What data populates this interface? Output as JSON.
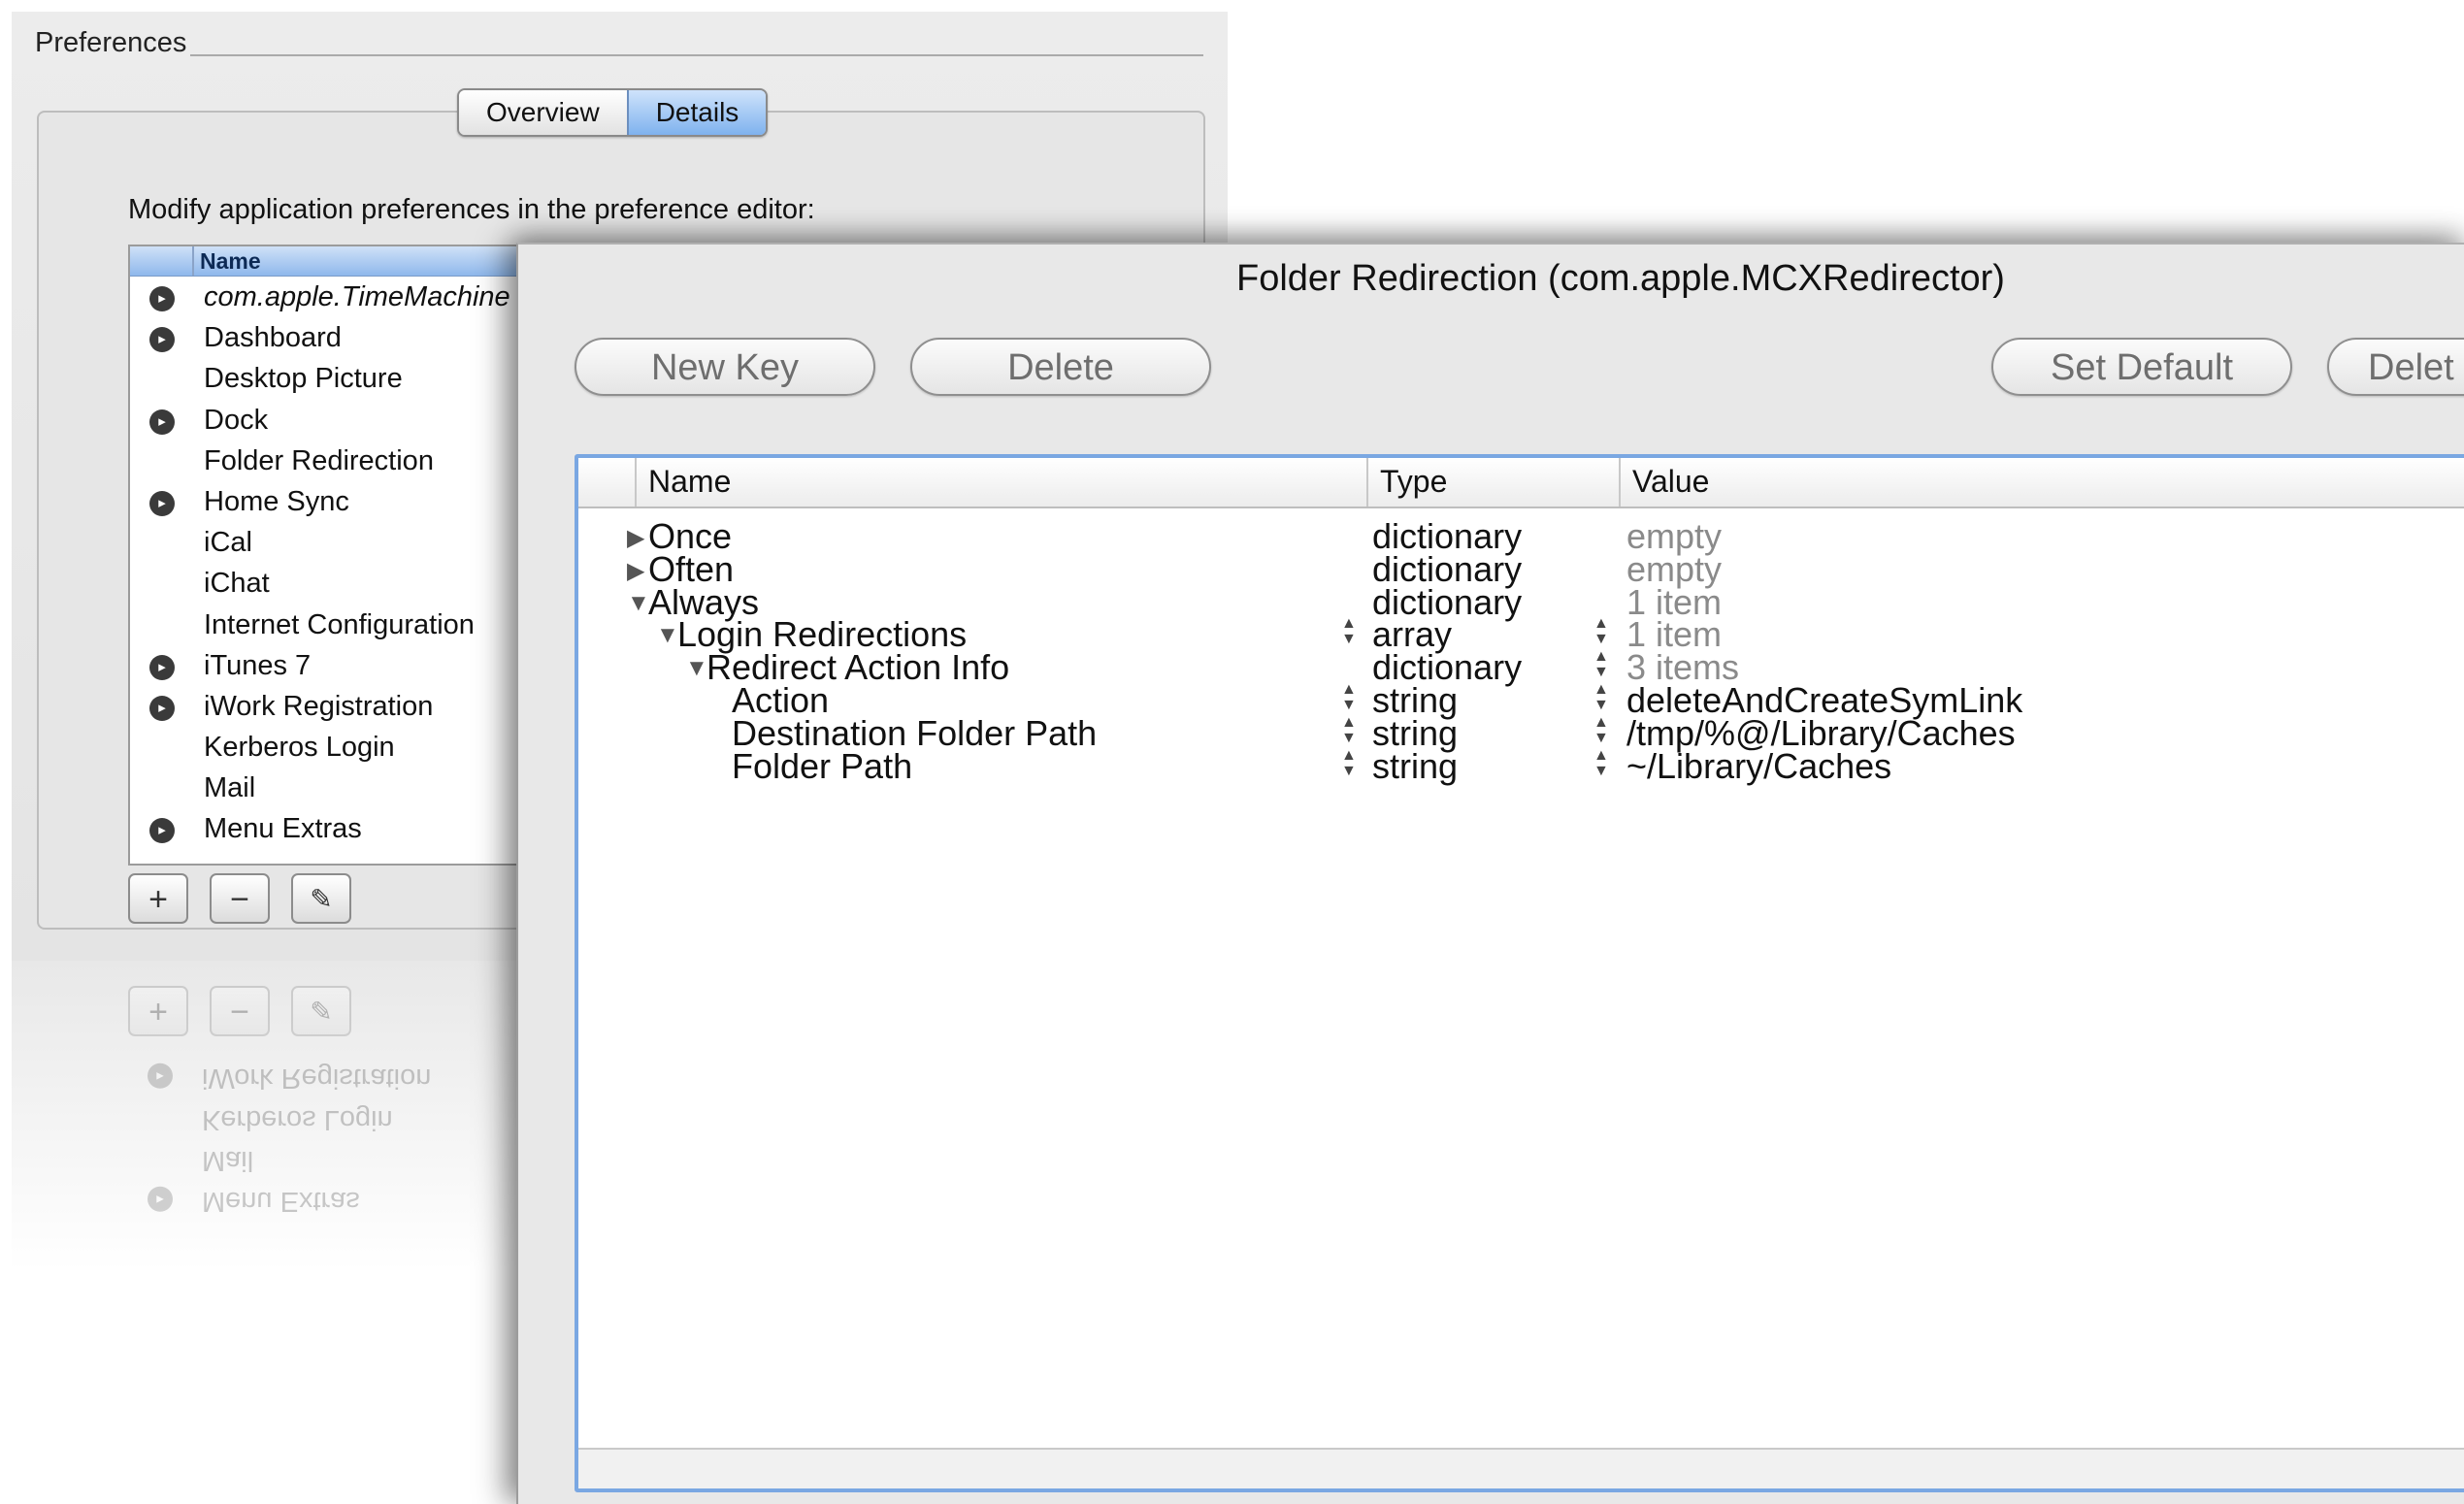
{
  "preferences": {
    "title": "Preferences",
    "tabs": [
      {
        "label": "Overview",
        "selected": false
      },
      {
        "label": "Details",
        "selected": true
      }
    ],
    "instruction": "Modify application preferences in the preference editor:",
    "list_header": "Name",
    "apps": [
      {
        "label": "com.apple.TimeMachine",
        "managed": true,
        "italic": true
      },
      {
        "label": "Dashboard",
        "managed": true
      },
      {
        "label": "Desktop Picture",
        "managed": false
      },
      {
        "label": "Dock",
        "managed": true
      },
      {
        "label": "Folder Redirection",
        "managed": false
      },
      {
        "label": "Home Sync",
        "managed": true
      },
      {
        "label": "iCal",
        "managed": false
      },
      {
        "label": "iChat",
        "managed": false
      },
      {
        "label": "Internet Configuration",
        "managed": false
      },
      {
        "label": "iTunes 7",
        "managed": true
      },
      {
        "label": "iWork Registration",
        "managed": true
      },
      {
        "label": "Kerberos Login",
        "managed": false
      },
      {
        "label": "Mail",
        "managed": false
      },
      {
        "label": "Menu Extras",
        "managed": true
      }
    ],
    "buttons": {
      "add": "+",
      "remove": "−",
      "edit": "✎"
    }
  },
  "dialog": {
    "title": "Folder Redirection (com.apple.MCXRedirector)",
    "buttons": {
      "new_key": "New Key",
      "delete": "Delete",
      "set_default": "Set Default",
      "delete_right": "Delet"
    },
    "columns": {
      "name": "Name",
      "type": "Type",
      "value": "Value"
    },
    "rows": [
      {
        "name": "Once",
        "indent": 0,
        "disclosure": "closed",
        "type": "dictionary",
        "value": "empty",
        "value_dim": true,
        "name_stepper": false,
        "type_stepper": false
      },
      {
        "name": "Often",
        "indent": 0,
        "disclosure": "closed",
        "type": "dictionary",
        "value": "empty",
        "value_dim": true,
        "name_stepper": false,
        "type_stepper": false
      },
      {
        "name": "Always",
        "indent": 0,
        "disclosure": "open",
        "type": "dictionary",
        "value": "1 item",
        "value_dim": true,
        "name_stepper": false,
        "type_stepper": false
      },
      {
        "name": "Login Redirections",
        "indent": 1,
        "disclosure": "open",
        "type": "array",
        "value": "1 item",
        "value_dim": true,
        "name_stepper": true,
        "type_stepper": true
      },
      {
        "name": "Redirect Action Info",
        "indent": 2,
        "disclosure": "open",
        "type": "dictionary",
        "value": "3 items",
        "value_dim": true,
        "name_stepper": false,
        "type_stepper": true
      },
      {
        "name": "Action",
        "indent": 3,
        "disclosure": "none",
        "type": "string",
        "value": "deleteAndCreateSymLink",
        "value_dim": false,
        "name_stepper": true,
        "type_stepper": true
      },
      {
        "name": "Destination Folder Path",
        "indent": 3,
        "disclosure": "none",
        "type": "string",
        "value": "/tmp/%@/Library/Caches",
        "value_dim": false,
        "name_stepper": true,
        "type_stepper": true
      },
      {
        "name": "Folder Path",
        "indent": 3,
        "disclosure": "none",
        "type": "string",
        "value": "~/Library/Caches",
        "value_dim": false,
        "name_stepper": true,
        "type_stepper": true
      }
    ]
  },
  "colors": {
    "accent": "#7aa7e2",
    "selected_tab": "#7fb2ee",
    "dim_text": "#8a8a8a"
  }
}
